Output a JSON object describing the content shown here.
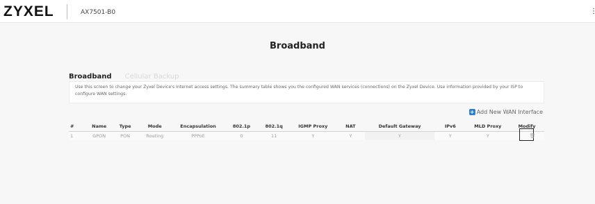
{
  "header": {
    "brand": "ZYXEL",
    "model": "AX7501-B0",
    "menu_icon": "menu-icon"
  },
  "page": {
    "title": "Broadband"
  },
  "tabs": [
    {
      "label": "Broadband",
      "active": true
    },
    {
      "label": "Cellular Backup",
      "active": false
    }
  ],
  "description": "Use this screen to change your Zyxel Device's Internet access settings. The summary table shows you the configured WAN services (connections) on the Zyxel Device. Use information provided by your ISP to configure WAN settings.",
  "add_wan": {
    "label": "Add New WAN Interface",
    "icon": "plus-icon"
  },
  "table": {
    "columns": [
      "#",
      "Name",
      "Type",
      "Mode",
      "Encapsulation",
      "802.1p",
      "802.1q",
      "IGMP Proxy",
      "NAT",
      "Default Gateway",
      "IPv6",
      "MLD Proxy",
      "Modify"
    ],
    "rows": [
      {
        "index": "1",
        "name": "GPON",
        "type": "PON",
        "mode": "Routing",
        "encapsulation": "PPPoE",
        "p8021p": "0",
        "q8021q": "11",
        "igmp_proxy": "Y",
        "nat": "Y",
        "default_gateway": "Y",
        "ipv6": "Y",
        "mld_proxy": "Y",
        "modify_icon": "trash-icon"
      }
    ]
  },
  "colors": {
    "accent": "#2b7fd0",
    "background": "#f7f7f7"
  }
}
